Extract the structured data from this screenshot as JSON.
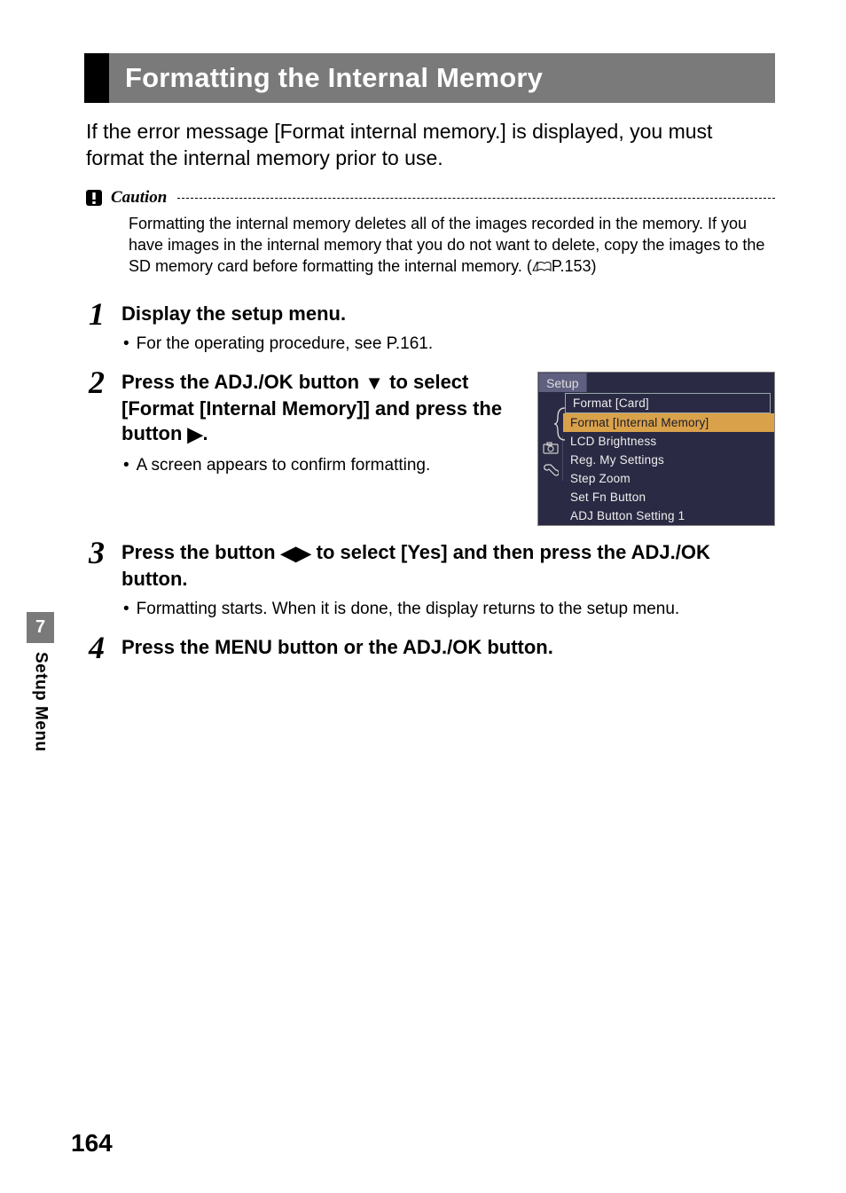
{
  "section": {
    "title": "Formatting the Internal Memory"
  },
  "intro": "If the error message [Format internal memory.] is displayed, you must format the internal memory prior to use.",
  "caution": {
    "label": "Caution",
    "body_prefix": "Formatting the internal memory deletes all of the images recorded in the memory. If you have images in the internal memory that you do not want to delete, copy the images to the SD memory card before formatting the internal memory. (",
    "ref": "P.153",
    "body_suffix": ")"
  },
  "steps": [
    {
      "num": "1",
      "head": "Display the setup menu.",
      "bullets": [
        "For the operating procedure, see P.161."
      ]
    },
    {
      "num": "2",
      "head_prefix": "Press the ADJ./OK button ",
      "head_mid": " to select [Format [Internal Memory]] and press the button ",
      "head_suffix": ".",
      "bullets": [
        "A screen appears to confirm formatting."
      ]
    },
    {
      "num": "3",
      "head_prefix": "Press the button ",
      "head_suffix": " to select [Yes] and then press the ADJ./OK button.",
      "bullets": [
        "Formatting starts. When it is done, the display returns to the setup menu."
      ]
    },
    {
      "num": "4",
      "head": "Press the MENU button or the ADJ./OK button."
    }
  ],
  "setup_screen": {
    "title": "Setup",
    "items": [
      "Format [Card]",
      "Format [Internal Memory]",
      "LCD Brightness",
      "Reg. My Settings",
      "Step Zoom",
      "Set Fn Button",
      "ADJ Button Setting 1"
    ]
  },
  "sidebar": {
    "chapter": "7",
    "label": "Setup Menu"
  },
  "page_number": "164"
}
